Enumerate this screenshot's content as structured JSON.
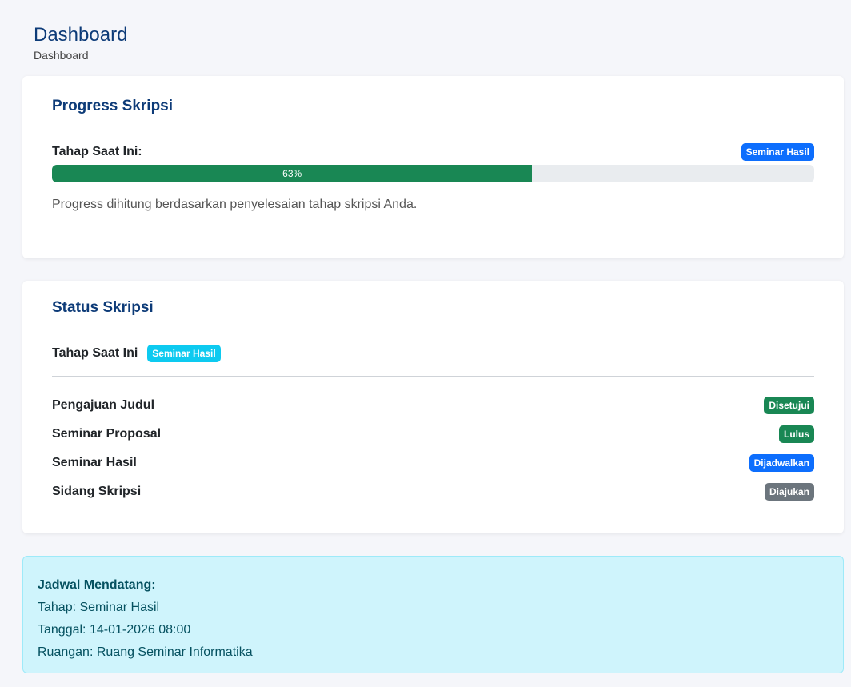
{
  "header": {
    "title": "Dashboard",
    "breadcrumb": "Dashboard"
  },
  "progress_card": {
    "title": "Progress Skripsi",
    "stage_label": "Tahap Saat Ini:",
    "stage_badge": "Seminar Hasil",
    "progress_percent": 63,
    "progress_text": "63%",
    "note": "Progress dihitung berdasarkan penyelesaian tahap skripsi Anda."
  },
  "status_card": {
    "title": "Status Skripsi",
    "current_label": "Tahap Saat Ini",
    "current_badge": "Seminar Hasil",
    "stages": [
      {
        "name": "Pengajuan Judul",
        "status": "Disetujui",
        "color": "#198754"
      },
      {
        "name": "Seminar Proposal",
        "status": "Lulus",
        "color": "#198754"
      },
      {
        "name": "Seminar Hasil",
        "status": "Dijadwalkan",
        "color": "#0d6efd"
      },
      {
        "name": "Sidang Skripsi",
        "status": "Diajukan",
        "color": "#6c757d"
      }
    ]
  },
  "schedule": {
    "title": "Jadwal Mendatang:",
    "stage": "Tahap: Seminar Hasil",
    "date": "Tanggal: 14-01-2026 08:00",
    "room": "Ruangan: Ruang Seminar Informatika"
  },
  "colors": {
    "title": "#0d3b78",
    "progress": "#198754",
    "primary": "#0d6efd",
    "info": "#0dcaf0",
    "alert_bg": "#cff4fc"
  }
}
